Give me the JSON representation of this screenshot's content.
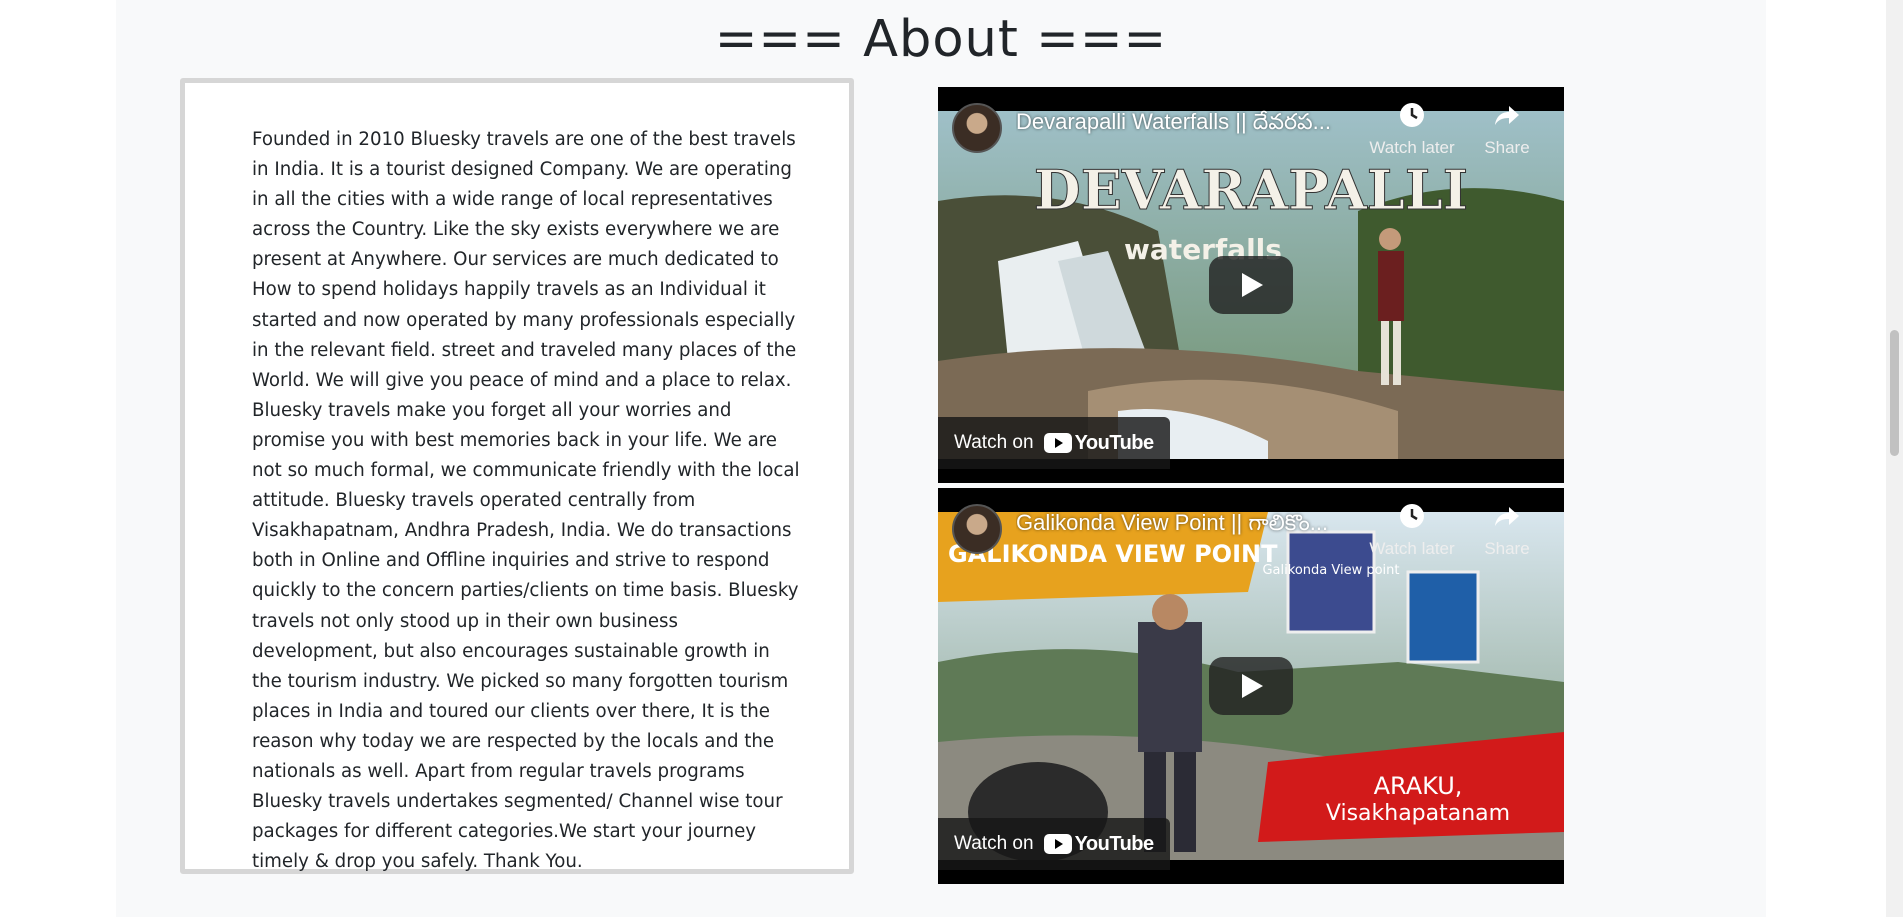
{
  "about": {
    "title": "=== About ===",
    "text": "Founded in 2010 Bluesky travels are one of the best travels in India. It is a tourist designed Company. We are operating in all the cities with a wide range of local representatives across the Country. Like the sky exists everywhere we are present at Anywhere. Our services are much dedicated to How to spend holidays happily travels as an Individual it started and now operated by many professionals especially in the relevant field. street and traveled many places of the World. We will give you peace of mind and a place to relax. Bluesky travels make you forget all your worries and promise you with best memories back in your life. We are not so much formal, we communicate friendly with the local attitude. Bluesky travels operated centrally from Visakhapatnam, Andhra Pradesh, India. We do transactions both in Online and Offline inquiries and strive to respond quickly to the concern parties/clients on time basis. Bluesky travels not only stood up in their own business development, but also encourages sustainable growth in the tourism industry. We picked so many forgotten tourism places in India and toured our clients over there, It is the reason why today we are respected by the locals and the nationals as well. Apart from regular travels programs Bluesky travels undertakes segmented/ Channel wise tour packages for different categories.We start your journey timely & drop you safely. Thank You."
  },
  "videos": [
    {
      "title": "Devarapalli Waterfalls || దేవరప...",
      "overlay_text_1": "DEVARAPALLI",
      "overlay_text_2": "waterfalls",
      "watch_later": "Watch later",
      "share": "Share",
      "watch_on": "Watch on",
      "youtube": "YouTube"
    },
    {
      "title": "Galikonda View Point || గాలికొం...",
      "overlay_text_1": "GALIKONDA VIEW POINT",
      "overlay_text_2": "ARAKU,",
      "overlay_text_3": "Visakhapatanam",
      "sign_text": "Galikonda View point",
      "watch_later": "Watch later",
      "share": "Share",
      "watch_on": "Watch on",
      "youtube": "YouTube"
    }
  ],
  "colors": {
    "page_bg": "#f8f9fa",
    "card_border": "#d6d6d6",
    "text": "#212529",
    "youtube_red": "#ff0000"
  }
}
